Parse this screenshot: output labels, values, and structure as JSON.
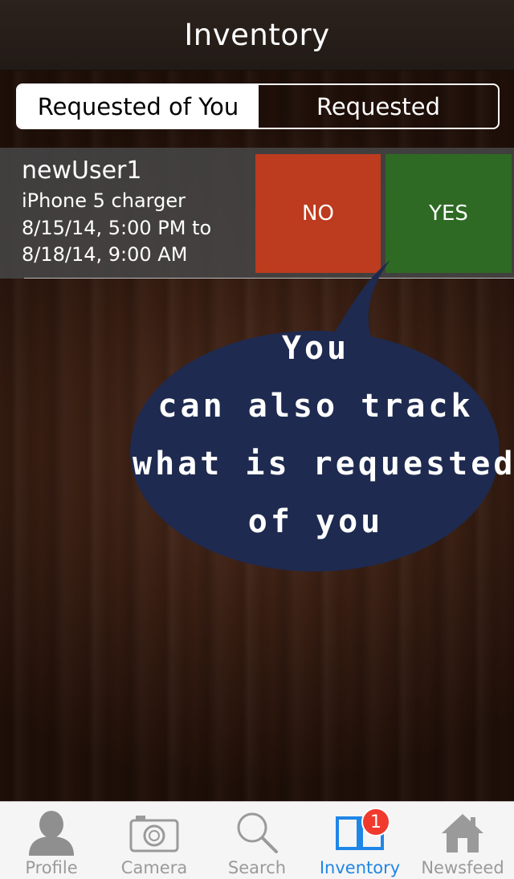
{
  "header": {
    "title": "Inventory"
  },
  "segmented_control": {
    "tabs": [
      {
        "label": "Requested of You",
        "selected": true
      },
      {
        "label": "Requested",
        "selected": false
      }
    ]
  },
  "requests": [
    {
      "user": "newUser1",
      "item": "iPhone 5 charger",
      "date_start": "8/15/14, 5:00 PM to",
      "date_end": "8/18/14, 9:00 AM",
      "no_label": "NO",
      "yes_label": "YES"
    }
  ],
  "callout": {
    "lines": [
      "You",
      "can also track",
      "what is requested",
      "of you"
    ]
  },
  "tabbar": {
    "items": [
      {
        "label": "Profile",
        "icon": "person-icon"
      },
      {
        "label": "Camera",
        "icon": "camera-icon"
      },
      {
        "label": "Search",
        "icon": "search-icon"
      },
      {
        "label": "Inventory",
        "icon": "book-icon",
        "active": true,
        "badge": "1"
      },
      {
        "label": "Newsfeed",
        "icon": "house-icon"
      }
    ]
  },
  "colors": {
    "no_button": "#bd3b1e",
    "yes_button": "#2f6a24",
    "bubble": "#1e2a4f",
    "active_tab": "#1f86e6",
    "badge": "#f03a2e"
  }
}
